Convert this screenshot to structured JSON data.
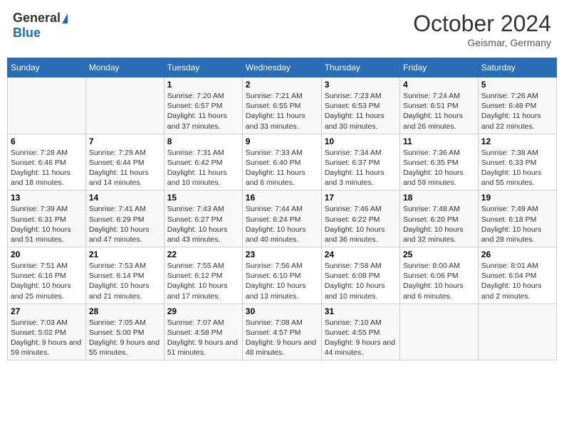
{
  "header": {
    "logo_general": "General",
    "logo_blue": "Blue",
    "month_title": "October 2024",
    "location": "Geismar, Germany"
  },
  "days_of_week": [
    "Sunday",
    "Monday",
    "Tuesday",
    "Wednesday",
    "Thursday",
    "Friday",
    "Saturday"
  ],
  "weeks": [
    [
      null,
      null,
      {
        "date": "1",
        "sunrise": "Sunrise: 7:20 AM",
        "sunset": "Sunset: 6:57 PM",
        "daylight": "Daylight: 11 hours and 37 minutes."
      },
      {
        "date": "2",
        "sunrise": "Sunrise: 7:21 AM",
        "sunset": "Sunset: 6:55 PM",
        "daylight": "Daylight: 11 hours and 33 minutes."
      },
      {
        "date": "3",
        "sunrise": "Sunrise: 7:23 AM",
        "sunset": "Sunset: 6:53 PM",
        "daylight": "Daylight: 11 hours and 30 minutes."
      },
      {
        "date": "4",
        "sunrise": "Sunrise: 7:24 AM",
        "sunset": "Sunset: 6:51 PM",
        "daylight": "Daylight: 11 hours and 26 minutes."
      },
      {
        "date": "5",
        "sunrise": "Sunrise: 7:26 AM",
        "sunset": "Sunset: 6:48 PM",
        "daylight": "Daylight: 11 hours and 22 minutes."
      }
    ],
    [
      {
        "date": "6",
        "sunrise": "Sunrise: 7:28 AM",
        "sunset": "Sunset: 6:46 PM",
        "daylight": "Daylight: 11 hours and 18 minutes."
      },
      {
        "date": "7",
        "sunrise": "Sunrise: 7:29 AM",
        "sunset": "Sunset: 6:44 PM",
        "daylight": "Daylight: 11 hours and 14 minutes."
      },
      {
        "date": "8",
        "sunrise": "Sunrise: 7:31 AM",
        "sunset": "Sunset: 6:42 PM",
        "daylight": "Daylight: 11 hours and 10 minutes."
      },
      {
        "date": "9",
        "sunrise": "Sunrise: 7:33 AM",
        "sunset": "Sunset: 6:40 PM",
        "daylight": "Daylight: 11 hours and 6 minutes."
      },
      {
        "date": "10",
        "sunrise": "Sunrise: 7:34 AM",
        "sunset": "Sunset: 6:37 PM",
        "daylight": "Daylight: 11 hours and 3 minutes."
      },
      {
        "date": "11",
        "sunrise": "Sunrise: 7:36 AM",
        "sunset": "Sunset: 6:35 PM",
        "daylight": "Daylight: 10 hours and 59 minutes."
      },
      {
        "date": "12",
        "sunrise": "Sunrise: 7:38 AM",
        "sunset": "Sunset: 6:33 PM",
        "daylight": "Daylight: 10 hours and 55 minutes."
      }
    ],
    [
      {
        "date": "13",
        "sunrise": "Sunrise: 7:39 AM",
        "sunset": "Sunset: 6:31 PM",
        "daylight": "Daylight: 10 hours and 51 minutes."
      },
      {
        "date": "14",
        "sunrise": "Sunrise: 7:41 AM",
        "sunset": "Sunset: 6:29 PM",
        "daylight": "Daylight: 10 hours and 47 minutes."
      },
      {
        "date": "15",
        "sunrise": "Sunrise: 7:43 AM",
        "sunset": "Sunset: 6:27 PM",
        "daylight": "Daylight: 10 hours and 43 minutes."
      },
      {
        "date": "16",
        "sunrise": "Sunrise: 7:44 AM",
        "sunset": "Sunset: 6:24 PM",
        "daylight": "Daylight: 10 hours and 40 minutes."
      },
      {
        "date": "17",
        "sunrise": "Sunrise: 7:46 AM",
        "sunset": "Sunset: 6:22 PM",
        "daylight": "Daylight: 10 hours and 36 minutes."
      },
      {
        "date": "18",
        "sunrise": "Sunrise: 7:48 AM",
        "sunset": "Sunset: 6:20 PM",
        "daylight": "Daylight: 10 hours and 32 minutes."
      },
      {
        "date": "19",
        "sunrise": "Sunrise: 7:49 AM",
        "sunset": "Sunset: 6:18 PM",
        "daylight": "Daylight: 10 hours and 28 minutes."
      }
    ],
    [
      {
        "date": "20",
        "sunrise": "Sunrise: 7:51 AM",
        "sunset": "Sunset: 6:16 PM",
        "daylight": "Daylight: 10 hours and 25 minutes."
      },
      {
        "date": "21",
        "sunrise": "Sunrise: 7:53 AM",
        "sunset": "Sunset: 6:14 PM",
        "daylight": "Daylight: 10 hours and 21 minutes."
      },
      {
        "date": "22",
        "sunrise": "Sunrise: 7:55 AM",
        "sunset": "Sunset: 6:12 PM",
        "daylight": "Daylight: 10 hours and 17 minutes."
      },
      {
        "date": "23",
        "sunrise": "Sunrise: 7:56 AM",
        "sunset": "Sunset: 6:10 PM",
        "daylight": "Daylight: 10 hours and 13 minutes."
      },
      {
        "date": "24",
        "sunrise": "Sunrise: 7:58 AM",
        "sunset": "Sunset: 6:08 PM",
        "daylight": "Daylight: 10 hours and 10 minutes."
      },
      {
        "date": "25",
        "sunrise": "Sunrise: 8:00 AM",
        "sunset": "Sunset: 6:06 PM",
        "daylight": "Daylight: 10 hours and 6 minutes."
      },
      {
        "date": "26",
        "sunrise": "Sunrise: 8:01 AM",
        "sunset": "Sunset: 6:04 PM",
        "daylight": "Daylight: 10 hours and 2 minutes."
      }
    ],
    [
      {
        "date": "27",
        "sunrise": "Sunrise: 7:03 AM",
        "sunset": "Sunset: 5:02 PM",
        "daylight": "Daylight: 9 hours and 59 minutes."
      },
      {
        "date": "28",
        "sunrise": "Sunrise: 7:05 AM",
        "sunset": "Sunset: 5:00 PM",
        "daylight": "Daylight: 9 hours and 55 minutes."
      },
      {
        "date": "29",
        "sunrise": "Sunrise: 7:07 AM",
        "sunset": "Sunset: 4:58 PM",
        "daylight": "Daylight: 9 hours and 51 minutes."
      },
      {
        "date": "30",
        "sunrise": "Sunrise: 7:08 AM",
        "sunset": "Sunset: 4:57 PM",
        "daylight": "Daylight: 9 hours and 48 minutes."
      },
      {
        "date": "31",
        "sunrise": "Sunrise: 7:10 AM",
        "sunset": "Sunset: 4:55 PM",
        "daylight": "Daylight: 9 hours and 44 minutes."
      },
      null,
      null
    ]
  ]
}
